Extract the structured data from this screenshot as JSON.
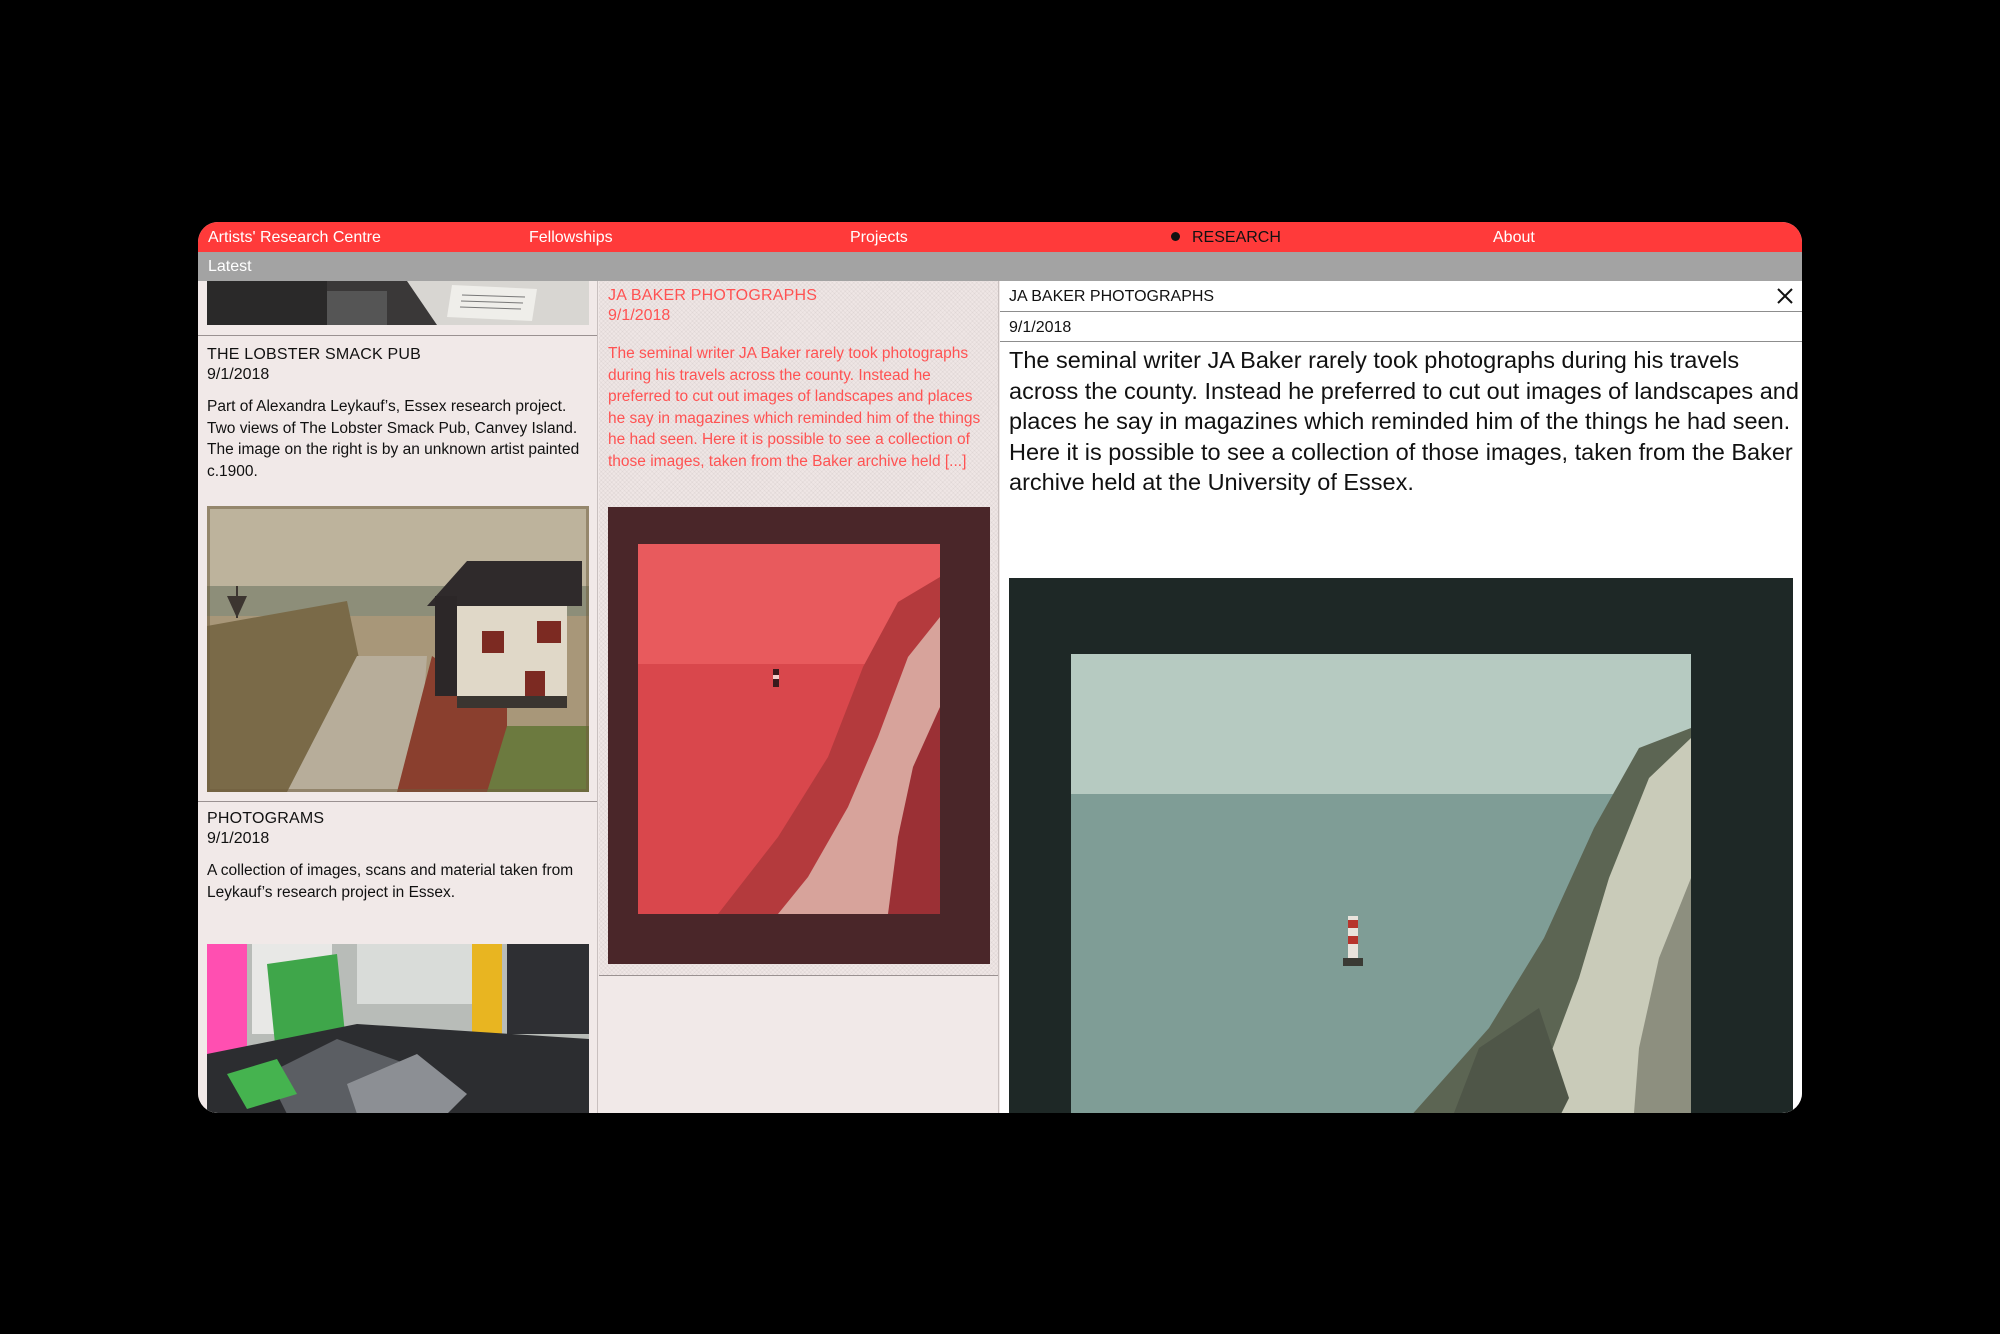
{
  "nav": {
    "brand": "Artists' Research Centre",
    "items": [
      "Fellowships",
      "Projects",
      "RESEARCH",
      "About"
    ],
    "active": "RESEARCH"
  },
  "subbar": {
    "label": "Latest"
  },
  "list_column": {
    "cards": [
      {
        "title": "THE LOBSTER SMACK PUB",
        "date": "9/1/2018",
        "text": "Part of Alexandra Leykauf’s, Essex research project. Two views of The Lobster Smack Pub, Canvey Island. The image on the right is by an unknown artist painted c.1900."
      },
      {
        "title": "PHOTOGRAMS",
        "date": "9/1/2018",
        "text": "A collection of images, scans and material taken from Leykauf’s research project in Essex."
      }
    ]
  },
  "middle_column": {
    "card": {
      "title": "JA BAKER PHOTOGRAPHS",
      "date": "9/1/2018",
      "text": "The seminal writer JA Baker rarely took photographs during his travels across the county. Instead he preferred to cut out images of landscapes and places he say in magazines which reminded him of the things he had seen. Here it is possible to see a collection of those images, taken from the Baker archive held [...]"
    }
  },
  "detail": {
    "title": "JA BAKER PHOTOGRAPHS",
    "date": "9/1/2018",
    "body": "The seminal writer JA Baker rarely took photographs during his travels across the county. Instead he preferred to cut out images of landscapes and places he say in magazines which reminded him of the things he had seen. Here it is possible to see a collection of those images, taken from the Baker archive held at the University of Essex."
  },
  "colors": {
    "nav_red": "#ff3a3a",
    "accent_text": "#ff5252",
    "subbar_gray": "#a3a3a3",
    "panel_bg": "#f1e9e8"
  },
  "icons": [
    "close-icon",
    "active-dot-icon"
  ]
}
